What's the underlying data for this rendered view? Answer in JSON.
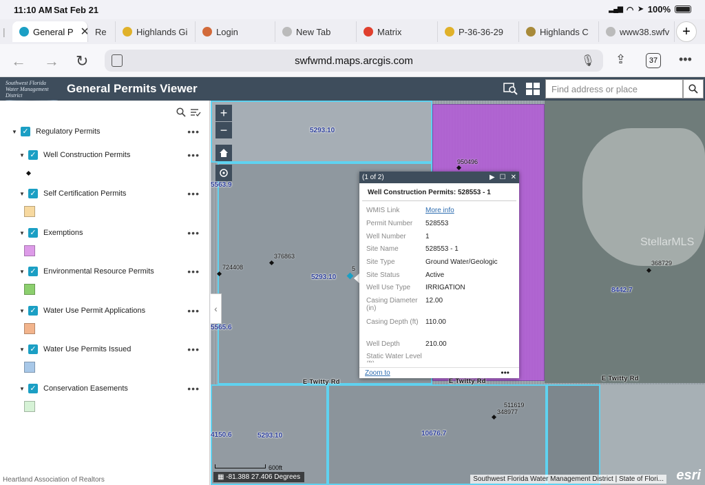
{
  "status": {
    "time": "11:10 AM",
    "date": "Sat Feb 21",
    "battery": "100%"
  },
  "browser": {
    "tabs": [
      {
        "label": "General P",
        "active": true,
        "color": "#1b9fc4"
      },
      {
        "label": "Re",
        "active": false,
        "color": "#c9c9c9"
      },
      {
        "label": "Highlands Gi",
        "active": false,
        "color": "#e0b12a"
      },
      {
        "label": "Login",
        "active": false,
        "color": "#d26a3a"
      },
      {
        "label": "New Tab",
        "active": false,
        "color": "#bbbbbb"
      },
      {
        "label": "Matrix",
        "active": false,
        "color": "#e0402e"
      },
      {
        "label": "P-36-36-29",
        "active": false,
        "color": "#e0b12a"
      },
      {
        "label": "Highlands C",
        "active": false,
        "color": "#a88a3a"
      },
      {
        "label": "www38.swfv",
        "active": false,
        "color": "#bbbbbb"
      }
    ],
    "url": "swfwmd.maps.arcgis.com",
    "tab_count": "37"
  },
  "app": {
    "logo_line1": "Southwest Florida",
    "logo_line2": "Water Management District",
    "title": "General Permits Viewer",
    "search_placeholder": "Find address or place"
  },
  "layers": {
    "root": "Regulatory Permits",
    "items": [
      {
        "label": "Well Construction Permits",
        "swatch": ""
      },
      {
        "label": "Self Certification Permits",
        "swatch": "#f7d9a0"
      },
      {
        "label": "Exemptions",
        "swatch": "#dd9be8"
      },
      {
        "label": "Environmental Resource Permits",
        "swatch": "#8ccf6e"
      },
      {
        "label": "Water Use Permit Applications",
        "swatch": "#f2b48c"
      },
      {
        "label": "Water Use Permits Issued",
        "swatch": "#a8c8e8"
      },
      {
        "label": "Conservation Easements",
        "swatch": "#d6f2d6"
      }
    ],
    "footer": "Heartland Association of Realtors"
  },
  "map": {
    "parcel_labels": [
      "5293.10",
      "5563.9",
      "5293.10",
      "5565.6",
      "8442.7",
      "4150.6",
      "5293.10",
      "10676.7"
    ],
    "points": [
      "950496",
      "376863",
      "724408",
      "368729",
      "511619",
      "348977",
      "5"
    ],
    "roads": [
      "E Twitty Rd",
      "E Twitty Rd",
      "E Twitty Rd"
    ],
    "watermark": "StellarMLS",
    "scale": "600ft",
    "coords": "-81.388 27.406 Degrees",
    "attribution": "Southwest Florida Water Management District | State of Flori...",
    "esri": "esri",
    "colors": {
      "purple_parcel": "#b45ad8",
      "parcel_line": "#5fd2f0"
    }
  },
  "popup": {
    "pager": "(1 of 2)",
    "title": "Well Construction Permits: 528553 - 1",
    "attributes": [
      {
        "name": "WMIS Link",
        "value": "More info"
      },
      {
        "name": "Permit Number",
        "value": "528553"
      },
      {
        "name": "Well Number",
        "value": "1"
      },
      {
        "name": "Site Name",
        "value": "528553 - 1"
      },
      {
        "name": "Site Type",
        "value": "Ground Water/Geologic"
      },
      {
        "name": "Site Status",
        "value": "Active"
      },
      {
        "name": "Well Use Type",
        "value": "IRRIGATION"
      },
      {
        "name": "Casing Diameter (in)",
        "value": "12.00"
      },
      {
        "name": "Casing Depth (ft)",
        "value": "110.00"
      },
      {
        "name": "Well Depth",
        "value": "210.00"
      },
      {
        "name": "Static Water Level (ft)",
        "value": ""
      }
    ],
    "zoom": "Zoom to"
  }
}
